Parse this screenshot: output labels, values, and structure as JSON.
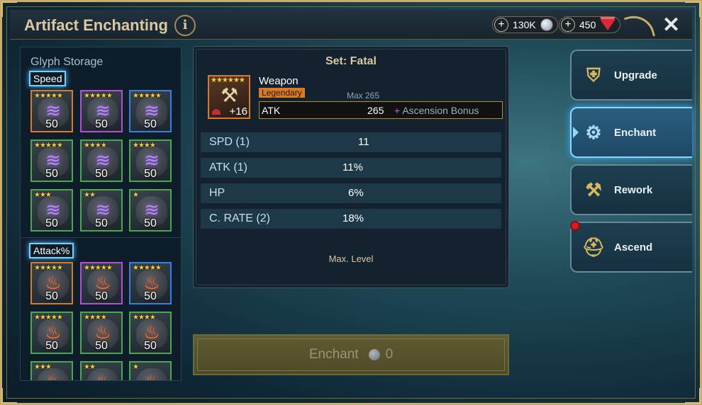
{
  "header": {
    "title": "Artifact Enchanting",
    "info_label": "i",
    "silver": "130K",
    "gems": "450",
    "close_label": "✕"
  },
  "storage": {
    "title": "Glyph Storage",
    "speed_label": "Speed",
    "attack_label": "Attack%",
    "speed_glyphs": [
      {
        "stars": "★★★★★",
        "level": "50",
        "rarity": "orange"
      },
      {
        "stars": "★★★★★",
        "level": "50",
        "rarity": "purple"
      },
      {
        "stars": "★★★★★",
        "level": "50",
        "rarity": "blue"
      },
      {
        "stars": "★★★★★",
        "level": "50",
        "rarity": "green"
      },
      {
        "stars": "★★★★",
        "level": "50",
        "rarity": "green"
      },
      {
        "stars": "★★★★",
        "level": "50",
        "rarity": "green"
      },
      {
        "stars": "★★★",
        "level": "50",
        "rarity": "green"
      },
      {
        "stars": "★★",
        "level": "50",
        "rarity": "green"
      },
      {
        "stars": "★",
        "level": "50",
        "rarity": "green"
      }
    ],
    "attack_glyphs": [
      {
        "stars": "★★★★★",
        "level": "50",
        "rarity": "orange"
      },
      {
        "stars": "★★★★★",
        "level": "50",
        "rarity": "purple"
      },
      {
        "stars": "★★★★★",
        "level": "50",
        "rarity": "blue"
      },
      {
        "stars": "★★★★★",
        "level": "50",
        "rarity": "green"
      },
      {
        "stars": "★★★★",
        "level": "50",
        "rarity": "green"
      },
      {
        "stars": "★★★★",
        "level": "50",
        "rarity": "green"
      },
      {
        "stars": "★★★",
        "level": "",
        "rarity": "green"
      },
      {
        "stars": "★★",
        "level": "",
        "rarity": "green"
      },
      {
        "stars": "★",
        "level": "",
        "rarity": "green"
      }
    ]
  },
  "artifact": {
    "set": "Set: Fatal",
    "slot": "Weapon",
    "rarity": "Legendary",
    "stars": "★★★★★★",
    "level": "+16",
    "max": "Max 265",
    "main_stat": {
      "name": "ATK",
      "value": "265",
      "ascension": "Ascension Bonus",
      "ascension_plus": "+"
    },
    "substats": [
      {
        "name": "SPD (1)",
        "value": "11"
      },
      {
        "name": "ATK (1)",
        "value": "11%"
      },
      {
        "name": "HP",
        "value": "6%"
      },
      {
        "name": "C. RATE (2)",
        "value": "18%"
      }
    ],
    "max_level": "Max. Level"
  },
  "enchant_button": {
    "label": "Enchant",
    "cost": "0"
  },
  "tabs": [
    {
      "label": "Upgrade",
      "icon": "armor-icon",
      "active": false
    },
    {
      "label": "Enchant",
      "icon": "anvil-icon",
      "active": true
    },
    {
      "label": "Rework",
      "icon": "hammer-wrench-icon",
      "active": false
    },
    {
      "label": "Ascend",
      "icon": "helmet-stars-icon",
      "active": false
    }
  ]
}
